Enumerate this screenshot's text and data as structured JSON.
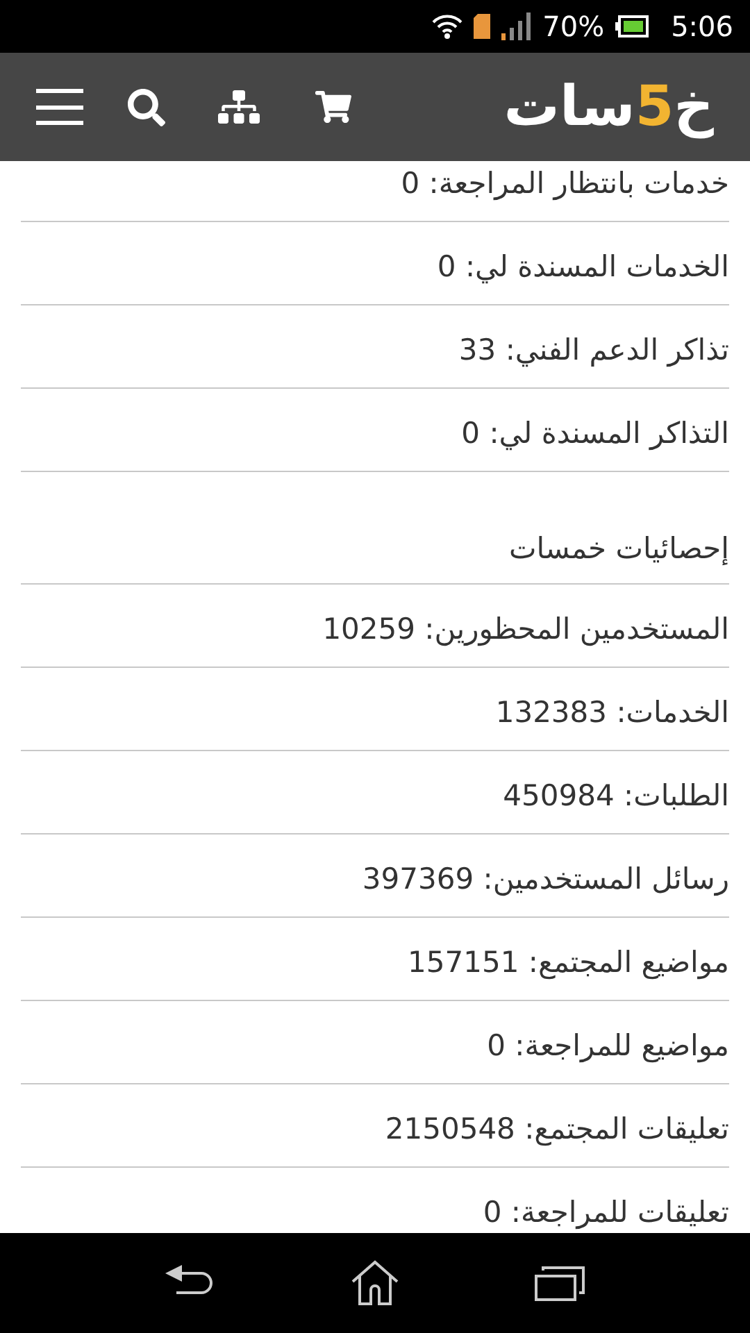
{
  "status_bar": {
    "battery": "70%",
    "time": "5:06"
  },
  "header": {
    "logo": [
      {
        "text": "خ",
        "color": "#ffffff"
      },
      {
        "text": "5",
        "color": "#f2b431"
      },
      {
        "text": "سات",
        "color": "#ffffff"
      }
    ]
  },
  "sections": [
    {
      "rows": [
        "خدمات بانتظار المراجعة: 0",
        "الخدمات المسندة لي: 0",
        "تذاكر الدعم الفني: 33",
        "التذاكر المسندة لي: 0"
      ]
    },
    {
      "title": "إحصائيات خمسات",
      "rows": [
        "المستخدمين المحظورين: 10259",
        "الخدمات: 132383",
        "الطلبات: 450984",
        "رسائل المستخدمين: 397369",
        "مواضيع المجتمع: 157151",
        "مواضيع للمراجعة: 0",
        "تعليقات المجتمع: 2150548",
        "تعليقات للمراجعة: 0"
      ]
    }
  ]
}
